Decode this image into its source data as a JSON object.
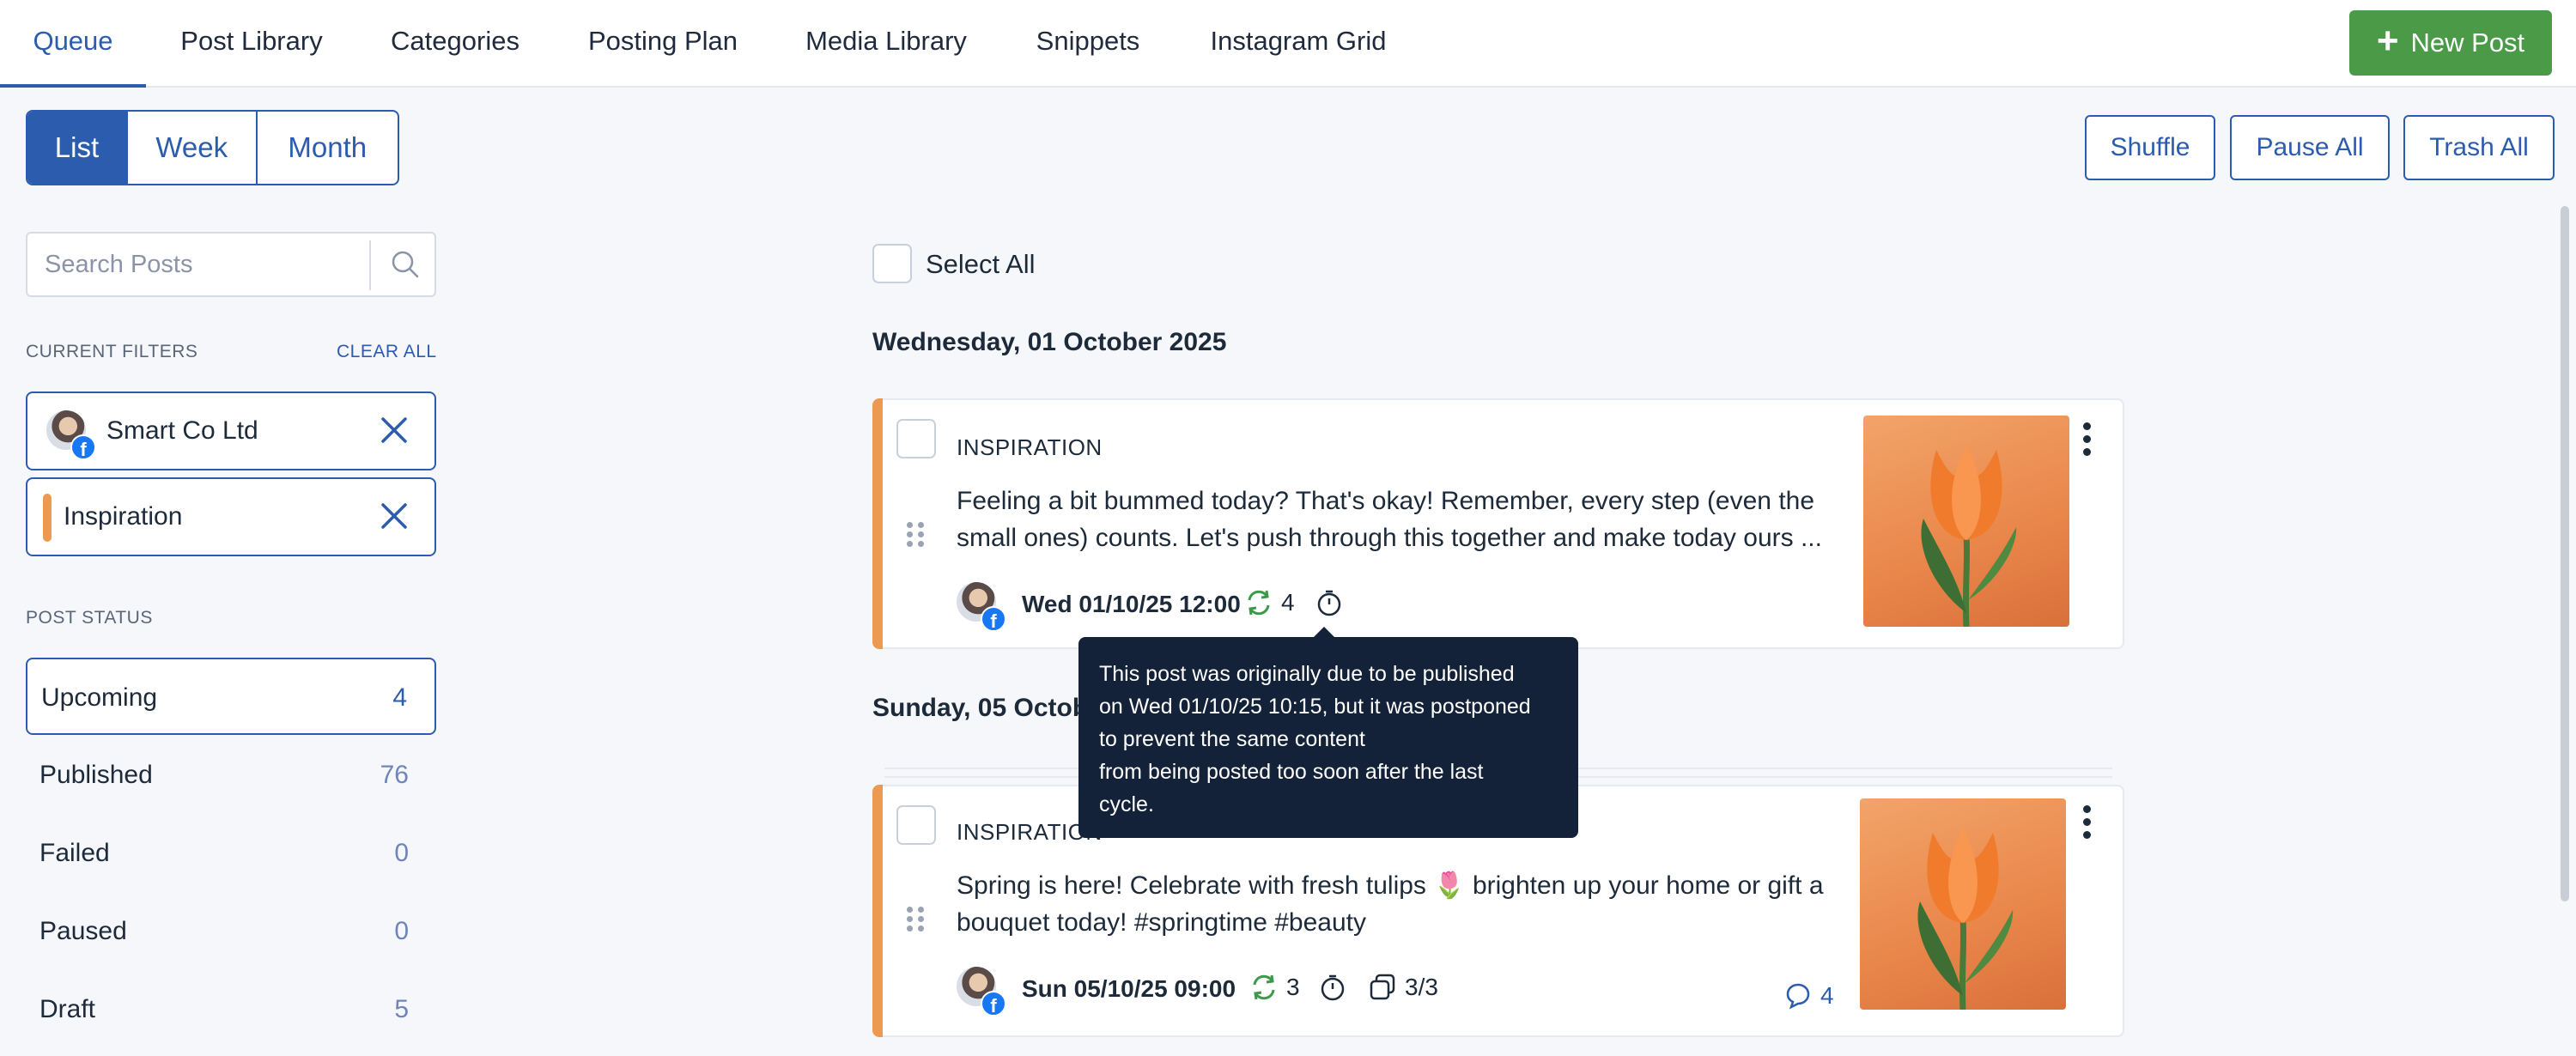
{
  "nav": {
    "tabs": [
      {
        "label": "Queue",
        "active": true
      },
      {
        "label": "Post Library"
      },
      {
        "label": "Categories"
      },
      {
        "label": "Posting Plan"
      },
      {
        "label": "Media Library"
      },
      {
        "label": "Snippets"
      },
      {
        "label": "Instagram Grid"
      }
    ],
    "new_post": "New Post"
  },
  "view_toggle": [
    "List",
    "Week",
    "Month"
  ],
  "actions": [
    "Shuffle",
    "Pause All",
    "Trash All"
  ],
  "search": {
    "placeholder": "Search Posts"
  },
  "filters": {
    "title": "CURRENT FILTERS",
    "clear": "CLEAR ALL",
    "chips": [
      {
        "label": "Smart Co Ltd",
        "icon": "facebook-avatar"
      },
      {
        "label": "Inspiration",
        "color": "#ec9a52"
      }
    ]
  },
  "post_status": {
    "title": "POST STATUS",
    "items": [
      {
        "name": "Upcoming",
        "count": "4",
        "active": true
      },
      {
        "name": "Published",
        "count": "76"
      },
      {
        "name": "Failed",
        "count": "0"
      },
      {
        "name": "Paused",
        "count": "0"
      },
      {
        "name": "Draft",
        "count": "5"
      }
    ]
  },
  "main": {
    "select_all": "Select All",
    "groups": [
      {
        "date": "Wednesday, 01 October 2025",
        "posts": [
          {
            "category": "INSPIRATION",
            "text": "Feeling a bit bummed today? That's okay! Remember, every step (even the small ones) counts. Let's push through this together and make today ours ...",
            "datetime": "Wed 01/10/25 12:00",
            "repeat": "4"
          }
        ]
      },
      {
        "date": "Sunday, 05 October 2025",
        "date_visible": "Sunday, 05 Octob",
        "posts": [
          {
            "category": "INSPIRATION",
            "text": "Spring is here! Celebrate with fresh tulips 🌷 brighten up your home or gift a bouquet today! #springtime #beauty",
            "datetime": "Sun 05/10/25 09:00",
            "repeat": "3",
            "variations": "3/3",
            "comments": "4"
          }
        ]
      }
    ]
  },
  "tooltip": {
    "lines": [
      "This post was originally due to be published",
      "on Wed 01/10/25 10:15, but it was postponed",
      "to prevent the same content",
      "from being posted too soon after the last",
      "cycle."
    ]
  },
  "colors": {
    "brand": "#2c5cad",
    "new_post": "#4a9a48",
    "category_accent": "#ec9a52",
    "tooltip_bg": "#132238"
  }
}
